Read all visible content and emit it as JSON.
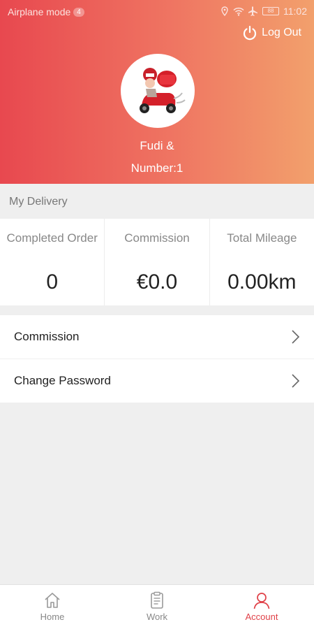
{
  "status_bar": {
    "mode_label": "Airplane mode",
    "notification_count": "4",
    "battery": "88",
    "time": "11:02"
  },
  "header": {
    "logout_label": "Log Out",
    "user_name": "Fudi &",
    "user_number": "Number:1"
  },
  "my_delivery": {
    "title": "My Delivery",
    "stats": [
      {
        "label": "Completed Order",
        "value": "0"
      },
      {
        "label": "Commission",
        "value": "€0.0"
      },
      {
        "label": "Total Mileage",
        "value": "0.00km"
      }
    ]
  },
  "menu": {
    "items": [
      {
        "label": "Commission",
        "icon": "chevron-right-icon"
      },
      {
        "label": "Change Password",
        "icon": "chevron-right-icon"
      }
    ]
  },
  "tabbar": {
    "tabs": [
      {
        "label": "Home",
        "icon": "home-icon",
        "active": false
      },
      {
        "label": "Work",
        "icon": "clipboard-icon",
        "active": false
      },
      {
        "label": "Account",
        "icon": "person-icon",
        "active": true
      }
    ]
  },
  "colors": {
    "header_start": "#e8484f",
    "header_end": "#f2a06c",
    "accent": "#e04148"
  }
}
